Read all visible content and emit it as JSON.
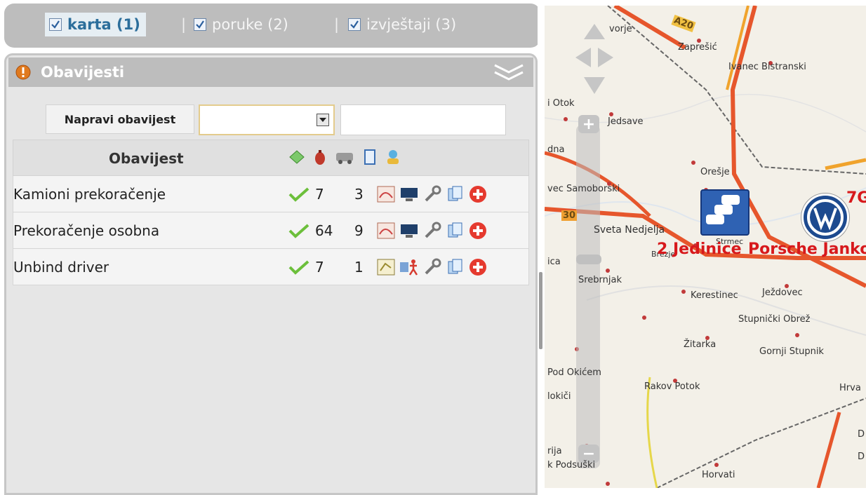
{
  "tabs": [
    {
      "label": "karta (1)",
      "active": true,
      "checked": true
    },
    {
      "label": "poruke (2)",
      "active": false,
      "checked": true
    },
    {
      "label": "izvještaji (3)",
      "active": false,
      "checked": true
    }
  ],
  "tab_separator": "|",
  "panel": {
    "title": "Obavijesti",
    "create_button": "Napravi obavijest",
    "select_value": "",
    "text_value": "",
    "table": {
      "header": "Obavijest",
      "header_icons": [
        "notify-area-icon",
        "alarm-icon",
        "vehicle-icon",
        "document-icon",
        "user-status-icon"
      ],
      "rows": [
        {
          "name": "Kamioni prekoračenje",
          "n1": "7",
          "n2": "3",
          "type_icon": "speed-chart-icon",
          "target_icon": "monitor-icon"
        },
        {
          "name": "Prekoračenje osobna",
          "n1": "64",
          "n2": "9",
          "type_icon": "speed-chart-icon",
          "target_icon": "monitor-icon"
        },
        {
          "name": "Unbind driver",
          "n1": "7",
          "n2": "1",
          "type_icon": "zone-chart-icon",
          "target_icon": "driver-icon"
        }
      ]
    }
  },
  "map": {
    "labels": [
      {
        "text": "vorje"
      },
      {
        "text": "Zaprešić"
      },
      {
        "text": "Ivanec Bistranski"
      },
      {
        "text": "i Otok"
      },
      {
        "text": "Jedsave"
      },
      {
        "text": "dna"
      },
      {
        "text": "Orešje"
      },
      {
        "text": "vec Samoborski"
      },
      {
        "text": "Sveta Nedjelja"
      },
      {
        "text": "Brezje"
      },
      {
        "text": "Strmec"
      },
      {
        "text": "ica"
      },
      {
        "text": "Srebrnjak"
      },
      {
        "text": "Kerestinec"
      },
      {
        "text": "Ježdovec"
      },
      {
        "text": "Stupnički Obrež"
      },
      {
        "text": "Žitarka"
      },
      {
        "text": "Gornji Stupnik"
      },
      {
        "text": "Pod Okićem"
      },
      {
        "text": "Rakov Potok"
      },
      {
        "text": "Hrva"
      },
      {
        "text": "lokiči"
      },
      {
        "text": "rija"
      },
      {
        "text": "k Podsuški"
      },
      {
        "text": "Horvati"
      },
      {
        "text": "D"
      },
      {
        "text": "D"
      }
    ],
    "road_labels": [
      "A20",
      "30"
    ],
    "red_labels": [
      "2 Jedinice",
      "Porsche Janko",
      "7G"
    ],
    "zoom_in": "+",
    "zoom_out": "−"
  }
}
